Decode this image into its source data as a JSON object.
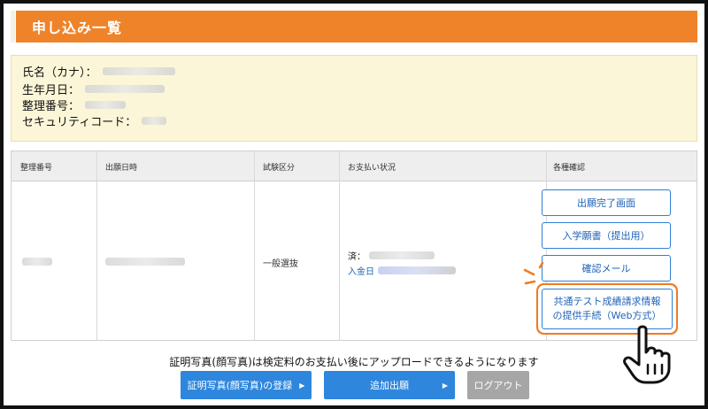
{
  "header": {
    "title": "申し込み一覧"
  },
  "applicant": {
    "name_label": "氏名（カナ）：",
    "birth_label": "生年月日：",
    "number_label": "整理番号：",
    "security_label": "セキュリティコード："
  },
  "table": {
    "headers": [
      "整理番号",
      "出願日時",
      "試験区分",
      "お支払い状況",
      "各種確認"
    ],
    "exam_type": "一般選抜",
    "payment_status_prefix": "済：",
    "payment_date_label": "入金日"
  },
  "actions": {
    "completion_screen": "出願完了画面",
    "admission_form": "入学願書（提出用）",
    "confirmation_mail": "確認メール",
    "test_results_line1": "共通テスト成績請求情報",
    "test_results_line2": "の提供手続（Web方式）"
  },
  "footer": {
    "notice": "証明写真(顔写真)は検定料のお支払い後にアップロードできるようになります",
    "photo_button": "証明写真(顔写真)の登録",
    "add_application_button": "追加出願",
    "logout_button": "ログアウト"
  },
  "icons": {
    "arrow": "▶",
    "pointer": "hand-pointer-icon"
  },
  "colors": {
    "accent": "#ef8329",
    "button_blue": "#2e86dd",
    "outline_blue": "#2f7fd8",
    "highlight_ring": "#f07a22",
    "info_bg": "#fcf6d8"
  }
}
